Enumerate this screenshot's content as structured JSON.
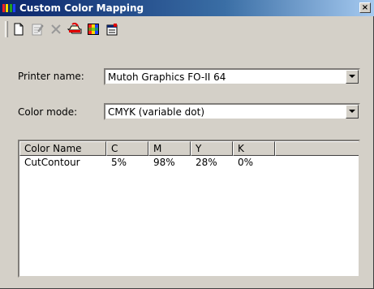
{
  "window": {
    "title": "Custom Color Mapping",
    "close_label": "×"
  },
  "toolbar": {
    "tools": [
      {
        "name": "new-icon"
      },
      {
        "name": "edit-icon"
      },
      {
        "name": "delete-icon"
      },
      {
        "name": "import-icon"
      },
      {
        "name": "color-palette-icon"
      },
      {
        "name": "properties-icon"
      }
    ]
  },
  "form": {
    "printer_label": "Printer name:",
    "printer_value": "Mutoh Graphics FO-II 64",
    "mode_label": "Color mode:",
    "mode_value": "CMYK (variable dot)"
  },
  "table": {
    "columns": [
      "Color Name",
      "C",
      "M",
      "Y",
      "K",
      ""
    ],
    "rows": [
      [
        "CutContour",
        "5%",
        "98%",
        "28%",
        "0%"
      ]
    ]
  },
  "colors": {
    "title_start": "#0a246a",
    "title_end": "#a6caf0",
    "face": "#d4d0c8"
  }
}
